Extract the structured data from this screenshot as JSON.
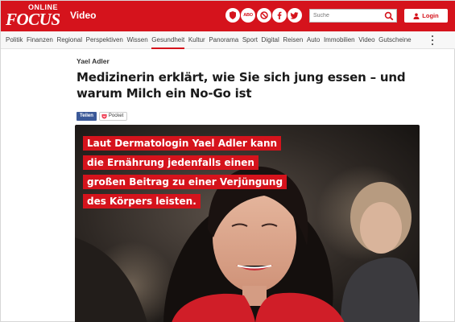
{
  "header": {
    "logo_online": "ONLINE",
    "logo_focus": "FOCUS",
    "section": "Video",
    "icons": [
      "shield-icon",
      "abo-icon",
      "ad-icon",
      "facebook-icon",
      "twitter-icon"
    ],
    "abo_label": "ABO",
    "search_placeholder": "Suche",
    "login_label": "Login",
    "brand_color": "#d5131c"
  },
  "nav": {
    "items": [
      "Politik",
      "Finanzen",
      "Regional",
      "Perspektiven",
      "Wissen",
      "Gesundheit",
      "Kultur",
      "Panorama",
      "Sport",
      "Digital",
      "Reisen",
      "Auto",
      "Immobilien",
      "Video",
      "Gutscheine"
    ],
    "active": "Gesundheit"
  },
  "article": {
    "author": "Yael Adler",
    "headline": "Medizinerin erklärt, wie Sie sich jung essen – und warum Milch ein No-Go ist",
    "share_label": "Teilen",
    "pocket_label": "Pocket"
  },
  "video": {
    "caption_lines": [
      "Laut Dermatologin Yael Adler kann",
      "die Ernährung jedenfalls einen",
      "großen Beitrag zu einer Verjüngung",
      "des Körpers leisten."
    ]
  }
}
